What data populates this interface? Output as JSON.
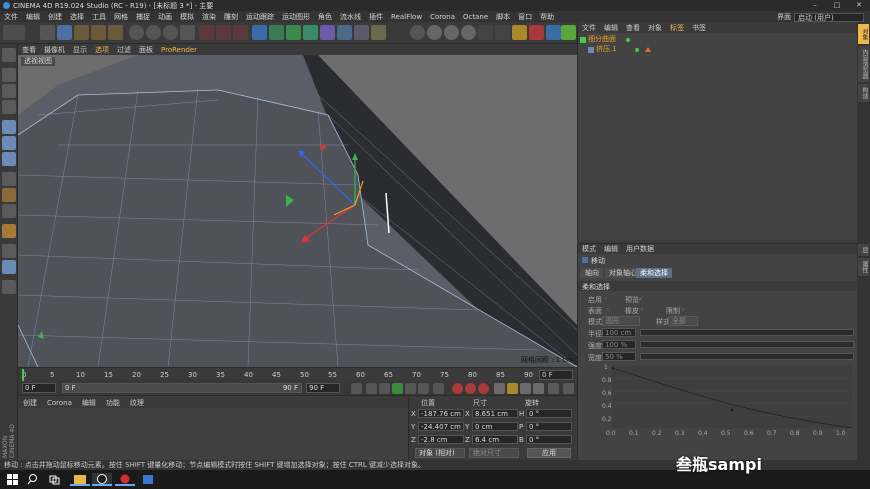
{
  "title_bar": {
    "text": "CINEMA 4D R19.024 Studio (RC - R19) - [未标题 3 *] - 主要"
  },
  "menu": [
    "文件",
    "编辑",
    "创建",
    "选择",
    "工具",
    "网格",
    "捕捉",
    "动画",
    "模拟",
    "渲染",
    "雕刻",
    "运动跟踪",
    "运动图形",
    "角色",
    "流水线",
    "插件",
    "RealFlow",
    "Corona",
    "Octane",
    "脚本",
    "窗口",
    "帮助"
  ],
  "layout": {
    "label": "界面",
    "value": "启动 (用户)"
  },
  "viewport_menu": {
    "items": [
      "查看",
      "摄像机",
      "显示",
      "选项",
      "过滤",
      "面板",
      "ProRender"
    ],
    "active": "选项"
  },
  "viewport": {
    "view_label": "透视视图",
    "grid_spacing": "网格间距 : 1 cm"
  },
  "timeline": {
    "ticks": [
      "0",
      "5",
      "10",
      "15",
      "20",
      "25",
      "30",
      "35",
      "40",
      "45",
      "50",
      "55",
      "60",
      "65",
      "70",
      "75",
      "80",
      "85",
      "90"
    ],
    "current_frame": "0 F"
  },
  "transport": {
    "start": "0 F",
    "range_start": "0 F",
    "range_end": "90 F",
    "end": "90 F"
  },
  "material_tabs": [
    "创建",
    "Corona",
    "编辑",
    "功能",
    "纹理"
  ],
  "maxon_text": "MAXON CINEMA 4D",
  "coordinates": {
    "headers": {
      "position": "位置",
      "size": "尺寸",
      "rotation": "旋转"
    },
    "rows": [
      {
        "axis": "X",
        "position": "-187.76 cm",
        "size_axis": "X",
        "size": "8.651 cm",
        "rot_axis": "H",
        "rotation": "0 °"
      },
      {
        "axis": "Y",
        "position": "-24.407 cm",
        "size_axis": "Y",
        "size": "0 cm",
        "rot_axis": "P",
        "rotation": "0 °"
      },
      {
        "axis": "Z",
        "position": "-2.8 cm",
        "size_axis": "Z",
        "size": "6.4 cm",
        "rot_axis": "B",
        "rotation": "0 °"
      }
    ],
    "mode": "对象 (相对)",
    "size_mode": "绝对尺寸",
    "apply": "应用"
  },
  "object_manager": {
    "menu": [
      "文件",
      "编辑",
      "查看",
      "对象",
      "标签",
      "书签"
    ],
    "active_menu": "标签",
    "objects": [
      {
        "name": "细分曲面"
      },
      {
        "name": "挤压.1"
      }
    ]
  },
  "attributes": {
    "menu": [
      "模式",
      "编辑",
      "用户数据"
    ],
    "tool": "移动",
    "tabs": [
      "轴向",
      "对象轴心",
      "柔和选择"
    ],
    "active_tab": "柔和选择",
    "section": "柔和选择",
    "enable_label": "启用",
    "preview_label": "预览",
    "surface_label": "表面",
    "rubber_label": "橡皮",
    "restrict_label": "限制",
    "mode_label": "模式",
    "mode_value": "圆形",
    "style_label": "样式",
    "style_value": "全部",
    "radius_label": "半径",
    "radius_value": "100 cm",
    "radius_fill": 0.18,
    "strength_label": "强度",
    "strength_value": "100 %",
    "strength_fill": 1.0,
    "width_label": "宽度",
    "width_value": "50 %",
    "width_fill": 0.5,
    "curve_y_labels": [
      "1",
      "0.8",
      "0.6",
      "0.4",
      "0.2"
    ],
    "curve_x_labels": [
      "0.0",
      "0.1",
      "0.2",
      "0.3",
      "0.4",
      "0.5",
      "0.6",
      "0.7",
      "0.8",
      "0.9",
      "1.0"
    ]
  },
  "side_tabs": [
    "对象",
    "内容浏览器",
    "构造",
    "层",
    "属性"
  ],
  "status": "移动 : 点击并拖动鼠标移动元素。按住 SHIFT 键量化移动；节点编辑模式时按住 SHIFT 键增加选择对象；按住 CTRL 键减少选择对象。",
  "watermark": "叁瓶sampi"
}
